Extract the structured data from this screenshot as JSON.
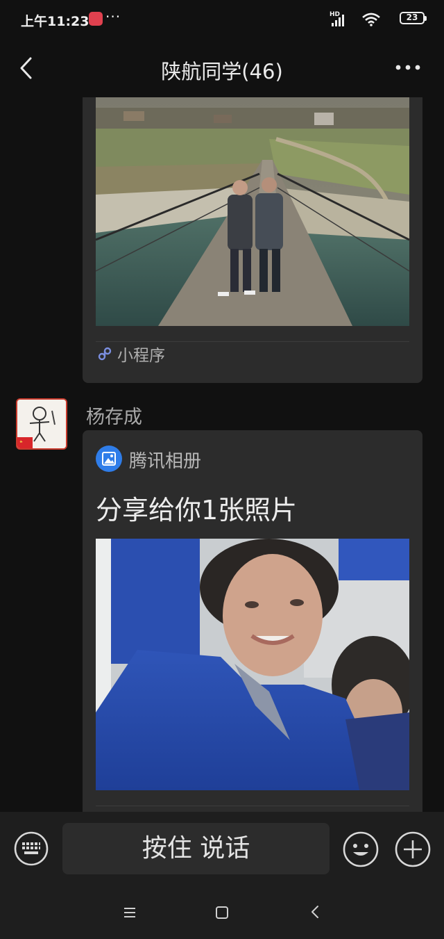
{
  "status_bar": {
    "time": "上午11:23",
    "more_indicator": "···",
    "network_label": "HD",
    "battery_level": "23",
    "icons": [
      "app-notification-icon",
      "signal-icon",
      "wifi-icon",
      "battery-icon"
    ]
  },
  "nav": {
    "title": "陕航同学(46)",
    "icons": [
      "back-icon",
      "more-options-icon"
    ]
  },
  "messages": [
    {
      "type": "mini-program-card",
      "image": "photo-two-men-on-suspension-bridge",
      "footer_label": "小程序",
      "footer_icon": "mini-program-icon"
    },
    {
      "type": "album-share",
      "sender": "杨存成",
      "avatar": "cartoon-avatar-with-flag",
      "source_label": "腾讯相册",
      "source_icon": "photo-album-icon",
      "title": "分享给你1张照片",
      "image": "photo-man-in-blue-jacket"
    }
  ],
  "input_bar": {
    "hold_to_talk_label": "按住 说话",
    "icons": [
      "keyboard-icon",
      "emoji-icon",
      "plus-icon"
    ]
  },
  "system_nav": {
    "icons": [
      "menu-icon",
      "home-icon",
      "back-icon"
    ]
  },
  "colors": {
    "background": "#111111",
    "bubble": "#2c2c2c",
    "input_bar": "#1e1e1e",
    "album_icon": "#2f7de9",
    "mini_program_icon": "#7b8fe0"
  }
}
